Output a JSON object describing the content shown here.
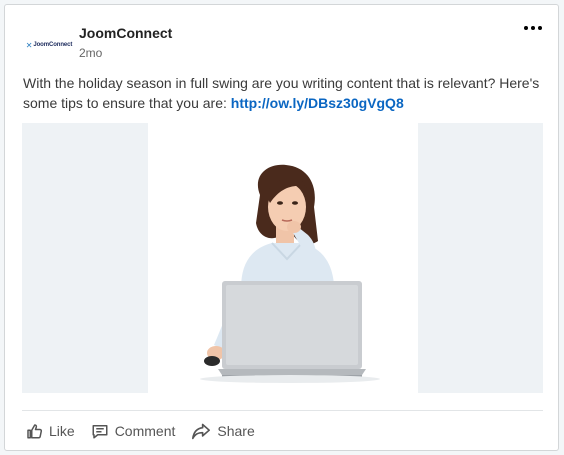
{
  "post": {
    "author": "JoomConnect",
    "logo_text": "JoomConnect",
    "timestamp": "2mo",
    "text": "With the holiday season in full swing are you writing content that is relevant? Here's some tips to ensure that you are: ",
    "link": "http://ow.ly/DBsz30gVgQ8",
    "image_alt": "Woman thinking in front of a laptop"
  },
  "actions": {
    "like": "Like",
    "comment": "Comment",
    "share": "Share"
  },
  "icons": {
    "more": "more-options-icon",
    "like": "thumbs-up-icon",
    "comment": "comment-icon",
    "share": "share-arrow-icon"
  },
  "colors": {
    "link": "#0a66c2",
    "media_side_panels": "#eef2f5"
  }
}
